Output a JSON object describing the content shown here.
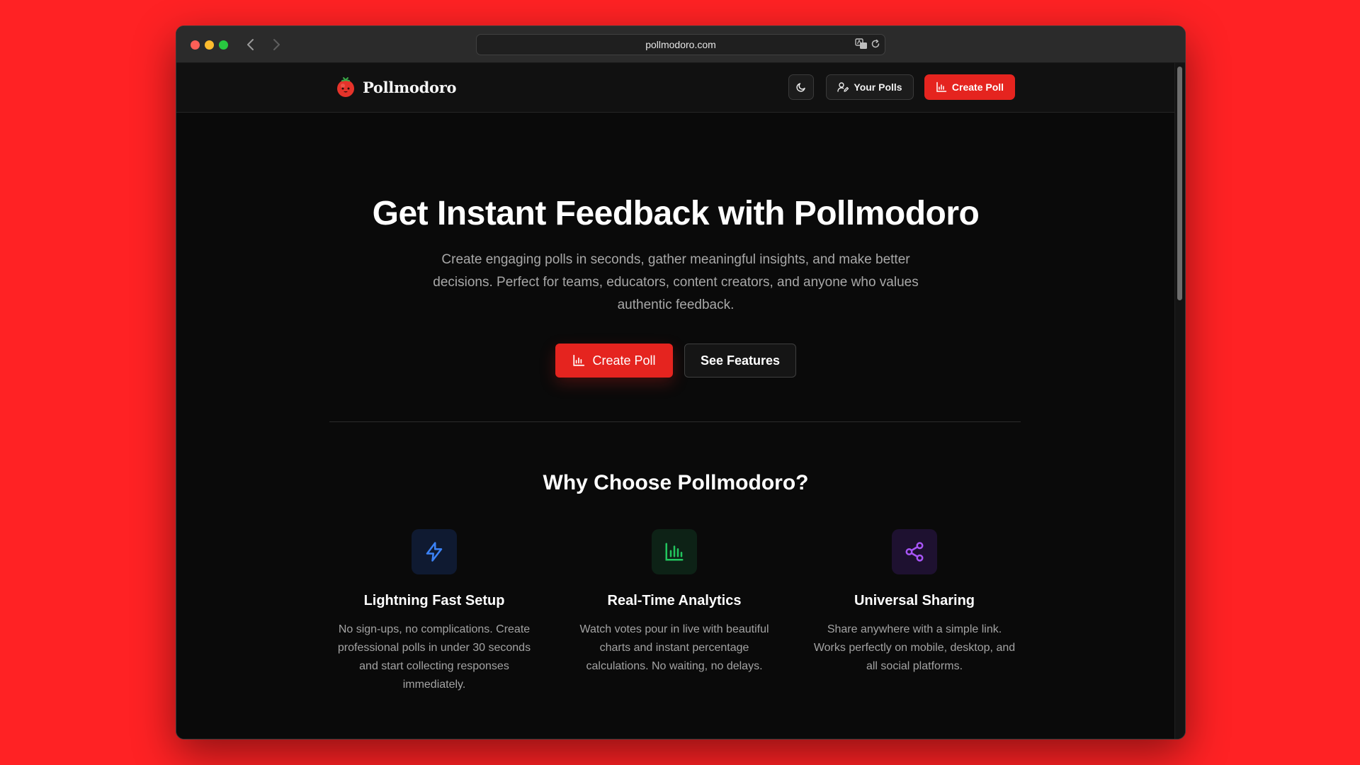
{
  "browser": {
    "url": "pollmodoro.com"
  },
  "nav": {
    "brand": "Pollmodoro",
    "your_polls_label": "Your Polls",
    "create_poll_label": "Create Poll"
  },
  "hero": {
    "title": "Get Instant Feedback with Pollmodoro",
    "subtitle": "Create engaging polls in seconds, gather meaningful insights, and make better decisions. Perfect for teams, educators, content creators, and anyone who values authentic feedback.",
    "primary_cta": "Create Poll",
    "secondary_cta": "See Features"
  },
  "features": {
    "section_title": "Why Choose Pollmodoro?",
    "items": [
      {
        "icon": "lightning-icon",
        "title": "Lightning Fast Setup",
        "description": "No sign-ups, no complications. Create professional polls in under 30 seconds and start collecting responses immediately."
      },
      {
        "icon": "bar-chart-icon",
        "title": "Real-Time Analytics",
        "description": "Watch votes pour in live with beautiful charts and instant percentage calculations. No waiting, no delays."
      },
      {
        "icon": "share-icon",
        "title": "Universal Sharing",
        "description": "Share anywhere with a simple link. Works perfectly on mobile, desktop, and all social platforms."
      }
    ]
  },
  "colors": {
    "background_outer": "#ff2224",
    "accent": "#e5241f",
    "page_bg": "#0a0a0a",
    "feature_icon_blue": "#3b82f6",
    "feature_icon_green": "#22c55e",
    "feature_icon_purple": "#a855f7"
  }
}
